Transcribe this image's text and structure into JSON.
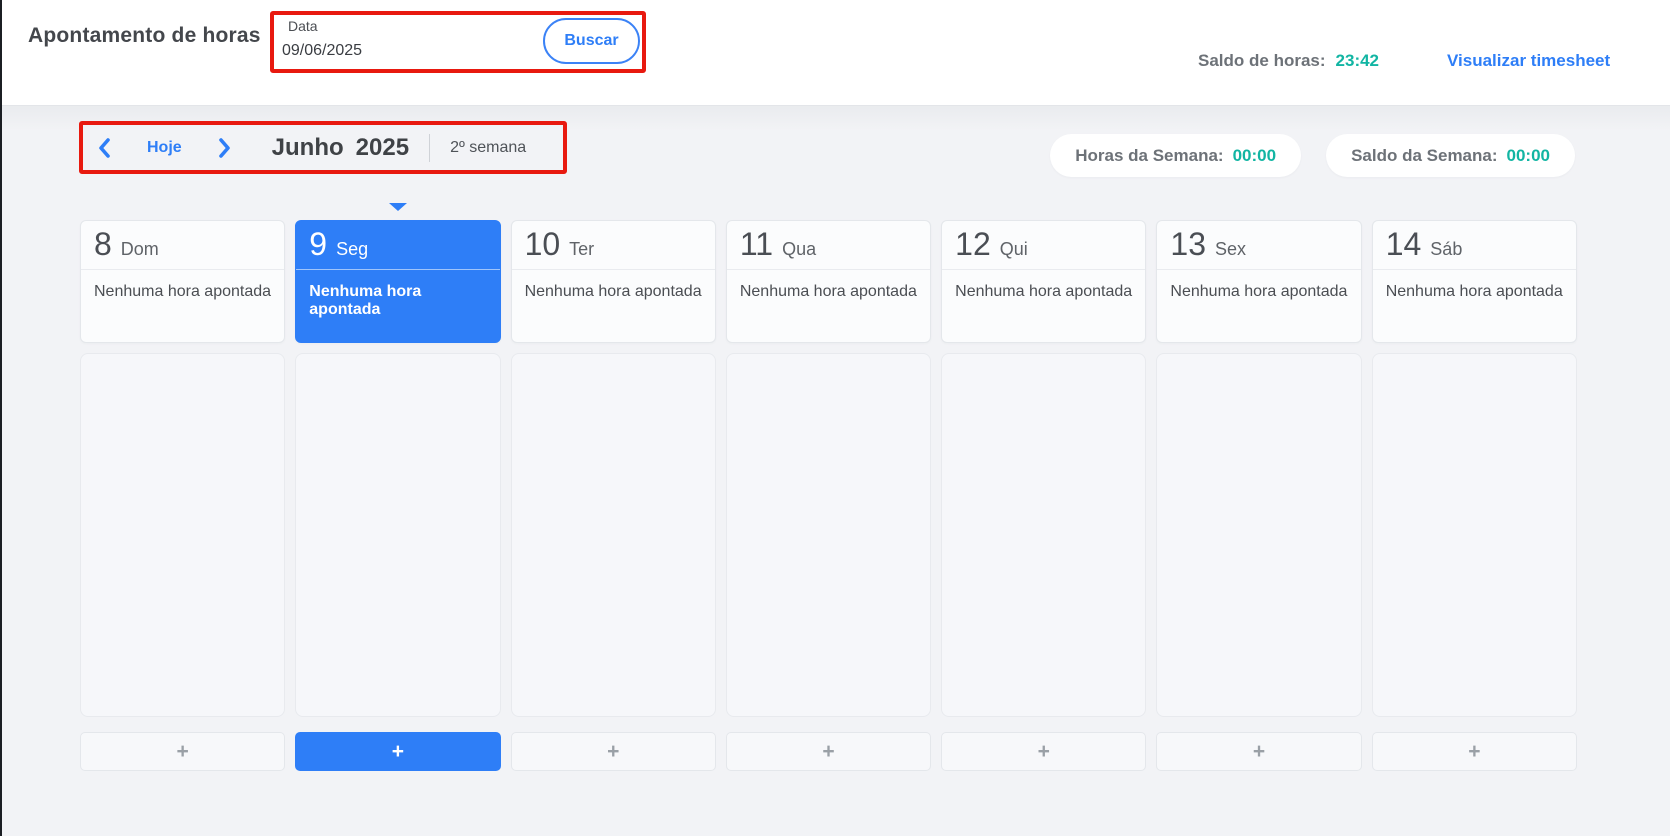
{
  "header": {
    "title": "Apontamento de horas",
    "date_field": {
      "label": "Data",
      "value": "09/06/2025"
    },
    "search_button_label": "Buscar",
    "hours_balance_label": "Saldo de horas:",
    "hours_balance_value": "23:42",
    "timesheet_link_label": "Visualizar timesheet"
  },
  "week_nav": {
    "prev_icon": "chevron-left",
    "today_button_label": "Hoje",
    "next_icon": "chevron-right",
    "month": "Junho",
    "year": "2025",
    "week_label": "2º semana"
  },
  "summary": {
    "week_hours_label": "Horas da Semana:",
    "week_hours_value": "00:00",
    "week_balance_label": "Saldo da Semana:",
    "week_balance_value": "00:00"
  },
  "days": [
    {
      "number": "8",
      "name": "Dom",
      "status": "Nenhuma hora apontada",
      "selected": false
    },
    {
      "number": "9",
      "name": "Seg",
      "status": "Nenhuma hora apontada",
      "selected": true
    },
    {
      "number": "10",
      "name": "Ter",
      "status": "Nenhuma hora apontada",
      "selected": false
    },
    {
      "number": "11",
      "name": "Qua",
      "status": "Nenhuma hora apontada",
      "selected": false
    },
    {
      "number": "12",
      "name": "Qui",
      "status": "Nenhuma hora apontada",
      "selected": false
    },
    {
      "number": "13",
      "name": "Sex",
      "status": "Nenhuma hora apontada",
      "selected": false
    },
    {
      "number": "14",
      "name": "Sáb",
      "status": "Nenhuma hora apontada",
      "selected": false
    }
  ],
  "actions": {
    "add_label": "+"
  },
  "annotation": {
    "color": "#e8190f",
    "highlighted_areas": [
      "date-search-field",
      "week-navigation"
    ]
  },
  "colors": {
    "accent_blue": "#2e7ef7",
    "teal": "#12b5a3",
    "annotation_red": "#e8190f",
    "page_background": "#f2f3f6"
  }
}
